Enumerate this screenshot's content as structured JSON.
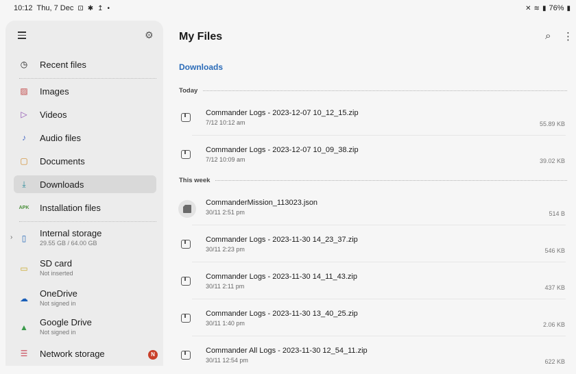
{
  "status_bar": {
    "time": "10:12",
    "date": "Thu, 7 Dec",
    "right": "76%"
  },
  "sidebar": {
    "items": [
      {
        "label": "Recent files",
        "icon": "clock-icon"
      },
      {
        "label": "Images",
        "icon": "image-icon"
      },
      {
        "label": "Videos",
        "icon": "video-icon"
      },
      {
        "label": "Audio files",
        "icon": "music-note-icon"
      },
      {
        "label": "Documents",
        "icon": "document-icon"
      },
      {
        "label": "Downloads",
        "icon": "download-icon",
        "active": true
      },
      {
        "label": "Installation files",
        "icon": "apk-icon",
        "icon_text": "APK"
      }
    ],
    "storage": [
      {
        "title": "Internal storage",
        "subtitle": "29.55 GB / 64.00 GB"
      },
      {
        "title": "SD card",
        "subtitle": "Not inserted"
      },
      {
        "title": "OneDrive",
        "subtitle": "Not signed in"
      },
      {
        "title": "Google Drive",
        "subtitle": "Not signed in"
      },
      {
        "title": "Network storage",
        "badge": "N"
      }
    ]
  },
  "main": {
    "title": "My Files",
    "breadcrumb": "Downloads",
    "sections": [
      {
        "label": "Today"
      },
      {
        "label": "This week"
      }
    ],
    "files": [
      {
        "name": "Commander Logs - 2023-12-07 10_12_15.zip",
        "date": "7/12 10:12 am",
        "size": "55.89 KB"
      },
      {
        "name": "Commander Logs - 2023-12-07 10_09_38.zip",
        "date": "7/12 10:09 am",
        "size": "39.02 KB"
      },
      {
        "name": "CommanderMission_113023.json",
        "date": "30/11 2:51 pm",
        "size": "514 B"
      },
      {
        "name": "Commander Logs - 2023-11-30 14_23_37.zip",
        "date": "30/11 2:23 pm",
        "size": "546 KB"
      },
      {
        "name": "Commander Logs - 2023-11-30 14_11_43.zip",
        "date": "30/11 2:11 pm",
        "size": "437 KB"
      },
      {
        "name": "Commander Logs - 2023-11-30 13_40_25.zip",
        "date": "30/11 1:40 pm",
        "size": "2.06 KB"
      },
      {
        "name": "Commander All Logs - 2023-11-30 12_54_11.zip",
        "date": "30/11 12:54 pm",
        "size": "622 KB"
      }
    ]
  },
  "colors": {
    "accent": "#2a6bb8",
    "apk": "#4a8f3a",
    "badge": "#c9402a"
  }
}
